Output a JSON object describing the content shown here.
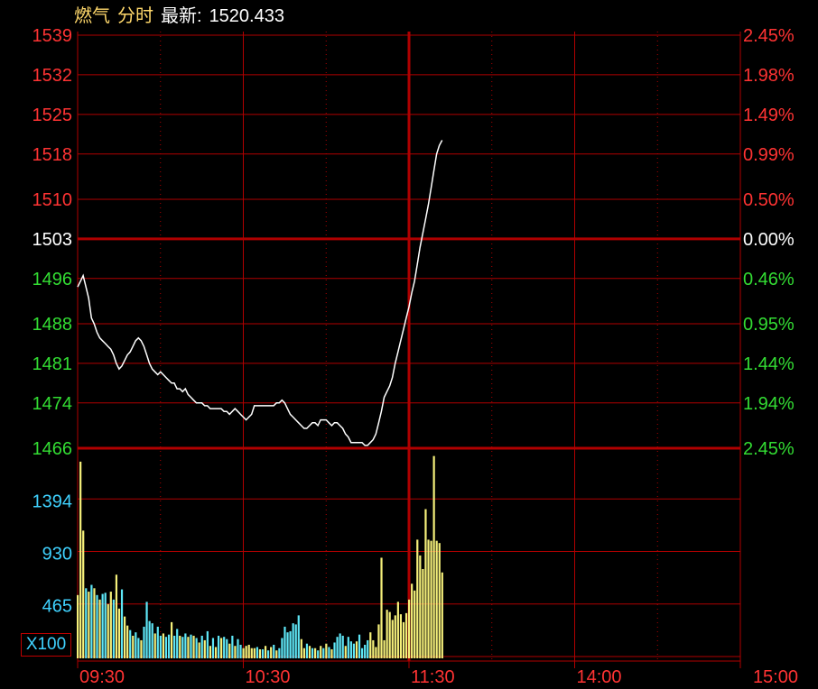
{
  "header": {
    "name": "燃气",
    "mode": "分时",
    "latest_label": "最新:",
    "latest_value": "1520.433"
  },
  "colors": {
    "background": "#000000",
    "grid": "#b00000",
    "up": "#ff3333",
    "down": "#33dd33",
    "neutral": "#ffffff",
    "price_line": "#ffffff",
    "volume_up": "#f5f07a",
    "volume_down": "#5ee7f7",
    "volume_axis": "#3fd2ff",
    "title": "#ffd86b"
  },
  "chart_data": {
    "type": "line",
    "prev_close": 1503,
    "price_axis": {
      "ylim": [
        1466,
        1539
      ],
      "ticks": [
        {
          "label": "1539",
          "value": 1539,
          "side": "up"
        },
        {
          "label": "1532",
          "value": 1532,
          "side": "up"
        },
        {
          "label": "1525",
          "value": 1525,
          "side": "up"
        },
        {
          "label": "1518",
          "value": 1518,
          "side": "up"
        },
        {
          "label": "1510",
          "value": 1510,
          "side": "up"
        },
        {
          "label": "1503",
          "value": 1503,
          "side": "flat"
        },
        {
          "label": "1496",
          "value": 1496,
          "side": "down"
        },
        {
          "label": "1488",
          "value": 1488,
          "side": "down"
        },
        {
          "label": "1481",
          "value": 1481,
          "side": "down"
        },
        {
          "label": "1474",
          "value": 1474,
          "side": "down"
        },
        {
          "label": "1466",
          "value": 1466,
          "side": "down"
        }
      ]
    },
    "pct_axis": {
      "ticks": [
        {
          "label": "2.45%",
          "side": "up"
        },
        {
          "label": "1.98%",
          "side": "up"
        },
        {
          "label": "1.49%",
          "side": "up"
        },
        {
          "label": "0.99%",
          "side": "up"
        },
        {
          "label": "0.50%",
          "side": "up"
        },
        {
          "label": "0.00%",
          "side": "flat"
        },
        {
          "label": "0.46%",
          "side": "down"
        },
        {
          "label": "0.95%",
          "side": "down"
        },
        {
          "label": "1.44%",
          "side": "down"
        },
        {
          "label": "1.94%",
          "side": "down"
        },
        {
          "label": "2.45%",
          "side": "down"
        }
      ]
    },
    "x_axis": {
      "total_minutes": 240,
      "labels": [
        {
          "label": "09:30",
          "minute": 0
        },
        {
          "label": "10:30",
          "minute": 60
        },
        {
          "label": "11:30",
          "minute": 120
        },
        {
          "label": "14:00",
          "minute": 180
        },
        {
          "label": "15:00",
          "minute": 240
        }
      ]
    },
    "price_series": {
      "name": "",
      "points": [
        [
          0,
          1494.5
        ],
        [
          1,
          1495.5
        ],
        [
          2,
          1496.5
        ],
        [
          3,
          1494.5
        ],
        [
          4,
          1492.5
        ],
        [
          5,
          1489.0
        ],
        [
          6,
          1488.0
        ],
        [
          7,
          1486.5
        ],
        [
          8,
          1485.5
        ],
        [
          9,
          1485.0
        ],
        [
          10,
          1484.5
        ],
        [
          11,
          1484.0
        ],
        [
          12,
          1483.5
        ],
        [
          13,
          1482.5
        ],
        [
          14,
          1481.0
        ],
        [
          15,
          1480.0
        ],
        [
          16,
          1480.5
        ],
        [
          17,
          1481.5
        ],
        [
          18,
          1482.5
        ],
        [
          19,
          1483.0
        ],
        [
          20,
          1484.0
        ],
        [
          21,
          1485.0
        ],
        [
          22,
          1485.5
        ],
        [
          23,
          1485.0
        ],
        [
          24,
          1484.0
        ],
        [
          25,
          1482.5
        ],
        [
          26,
          1481.0
        ],
        [
          27,
          1480.0
        ],
        [
          28,
          1479.5
        ],
        [
          29,
          1479.0
        ],
        [
          30,
          1479.5
        ],
        [
          31,
          1479.0
        ],
        [
          32,
          1478.5
        ],
        [
          33,
          1478.0
        ],
        [
          34,
          1477.5
        ],
        [
          35,
          1477.5
        ],
        [
          36,
          1476.5
        ],
        [
          37,
          1476.5
        ],
        [
          38,
          1476.0
        ],
        [
          39,
          1476.5
        ],
        [
          40,
          1475.5
        ],
        [
          41,
          1475.0
        ],
        [
          42,
          1474.5
        ],
        [
          43,
          1474.0
        ],
        [
          44,
          1474.0
        ],
        [
          45,
          1474.0
        ],
        [
          46,
          1473.5
        ],
        [
          47,
          1473.5
        ],
        [
          48,
          1473.0
        ],
        [
          49,
          1473.0
        ],
        [
          50,
          1473.0
        ],
        [
          51,
          1473.0
        ],
        [
          52,
          1473.0
        ],
        [
          53,
          1472.5
        ],
        [
          54,
          1472.5
        ],
        [
          55,
          1472.0
        ],
        [
          56,
          1472.5
        ],
        [
          57,
          1473.0
        ],
        [
          58,
          1472.5
        ],
        [
          59,
          1472.0
        ],
        [
          60,
          1471.5
        ],
        [
          61,
          1471.0
        ],
        [
          62,
          1471.5
        ],
        [
          63,
          1472.0
        ],
        [
          64,
          1473.5
        ],
        [
          65,
          1473.5
        ],
        [
          66,
          1473.5
        ],
        [
          67,
          1473.5
        ],
        [
          68,
          1473.5
        ],
        [
          69,
          1473.5
        ],
        [
          70,
          1473.5
        ],
        [
          71,
          1473.5
        ],
        [
          72,
          1474.0
        ],
        [
          73,
          1474.0
        ],
        [
          74,
          1474.5
        ],
        [
          75,
          1474.0
        ],
        [
          76,
          1473.0
        ],
        [
          77,
          1472.0
        ],
        [
          78,
          1471.5
        ],
        [
          79,
          1471.0
        ],
        [
          80,
          1470.5
        ],
        [
          81,
          1470.0
        ],
        [
          82,
          1469.5
        ],
        [
          83,
          1469.5
        ],
        [
          84,
          1470.0
        ],
        [
          85,
          1470.5
        ],
        [
          86,
          1470.5
        ],
        [
          87,
          1470.0
        ],
        [
          88,
          1471.0
        ],
        [
          89,
          1471.0
        ],
        [
          90,
          1471.0
        ],
        [
          91,
          1470.5
        ],
        [
          92,
          1470.0
        ],
        [
          93,
          1470.5
        ],
        [
          94,
          1470.5
        ],
        [
          95,
          1470.0
        ],
        [
          96,
          1469.5
        ],
        [
          97,
          1468.5
        ],
        [
          98,
          1468.0
        ],
        [
          99,
          1467.0
        ],
        [
          100,
          1467.0
        ],
        [
          101,
          1467.0
        ],
        [
          102,
          1467.0
        ],
        [
          103,
          1467.0
        ],
        [
          104,
          1466.5
        ],
        [
          105,
          1466.5
        ],
        [
          106,
          1467.0
        ],
        [
          107,
          1467.5
        ],
        [
          108,
          1468.5
        ],
        [
          109,
          1470.5
        ],
        [
          110,
          1472.5
        ],
        [
          111,
          1475.0
        ],
        [
          112,
          1476.0
        ],
        [
          113,
          1477.0
        ],
        [
          114,
          1478.5
        ],
        [
          115,
          1481.0
        ],
        [
          116,
          1483.0
        ],
        [
          117,
          1485.0
        ],
        [
          118,
          1487.0
        ],
        [
          119,
          1489.0
        ],
        [
          120,
          1491.0
        ],
        [
          121,
          1493.5
        ],
        [
          122,
          1495.5
        ],
        [
          123,
          1498.5
        ],
        [
          124,
          1501.5
        ],
        [
          125,
          1504.0
        ],
        [
          126,
          1506.5
        ],
        [
          127,
          1509.0
        ],
        [
          128,
          1512.0
        ],
        [
          129,
          1515.0
        ],
        [
          130,
          1518.0
        ],
        [
          131,
          1519.5
        ],
        [
          132,
          1520.433
        ]
      ]
    },
    "volume_axis": {
      "ylim": [
        0,
        1859
      ],
      "unit_label": "X100",
      "ticks": [
        {
          "label": "1394",
          "value": 1394
        },
        {
          "label": "930",
          "value": 930
        },
        {
          "label": "465",
          "value": 465
        }
      ]
    },
    "volume_series": {
      "name": "",
      "bars": [
        [
          0,
          560,
          "up"
        ],
        [
          1,
          1740,
          "up"
        ],
        [
          2,
          1130,
          "up"
        ],
        [
          3,
          620,
          "down"
        ],
        [
          4,
          590,
          "up"
        ],
        [
          5,
          650,
          "down"
        ],
        [
          6,
          620,
          "up"
        ],
        [
          7,
          560,
          "down"
        ],
        [
          8,
          520,
          "up"
        ],
        [
          9,
          570,
          "down"
        ],
        [
          10,
          580,
          "down"
        ],
        [
          11,
          480,
          "up"
        ],
        [
          12,
          590,
          "up"
        ],
        [
          13,
          520,
          "down"
        ],
        [
          14,
          740,
          "up"
        ],
        [
          15,
          440,
          "up"
        ],
        [
          16,
          610,
          "down"
        ],
        [
          17,
          370,
          "up"
        ],
        [
          18,
          290,
          "up"
        ],
        [
          19,
          250,
          "down"
        ],
        [
          20,
          200,
          "up"
        ],
        [
          21,
          230,
          "down"
        ],
        [
          22,
          180,
          "down"
        ],
        [
          23,
          160,
          "up"
        ],
        [
          24,
          280,
          "down"
        ],
        [
          25,
          500,
          "down"
        ],
        [
          26,
          330,
          "down"
        ],
        [
          27,
          310,
          "down"
        ],
        [
          28,
          220,
          "up"
        ],
        [
          29,
          280,
          "down"
        ],
        [
          30,
          200,
          "down"
        ],
        [
          31,
          220,
          "up"
        ],
        [
          32,
          190,
          "down"
        ],
        [
          33,
          210,
          "down"
        ],
        [
          34,
          320,
          "up"
        ],
        [
          35,
          200,
          "down"
        ],
        [
          36,
          260,
          "down"
        ],
        [
          37,
          200,
          "up"
        ],
        [
          38,
          190,
          "down"
        ],
        [
          39,
          220,
          "down"
        ],
        [
          40,
          190,
          "up"
        ],
        [
          41,
          210,
          "down"
        ],
        [
          42,
          200,
          "up"
        ],
        [
          43,
          180,
          "down"
        ],
        [
          44,
          140,
          "up"
        ],
        [
          45,
          200,
          "down"
        ],
        [
          46,
          160,
          "up"
        ],
        [
          47,
          240,
          "down"
        ],
        [
          48,
          110,
          "up"
        ],
        [
          49,
          180,
          "down"
        ],
        [
          50,
          100,
          "up"
        ],
        [
          51,
          200,
          "down"
        ],
        [
          52,
          180,
          "up"
        ],
        [
          53,
          190,
          "down"
        ],
        [
          54,
          170,
          "down"
        ],
        [
          55,
          130,
          "up"
        ],
        [
          56,
          200,
          "down"
        ],
        [
          57,
          110,
          "up"
        ],
        [
          58,
          170,
          "down"
        ],
        [
          59,
          120,
          "down"
        ],
        [
          60,
          90,
          "up"
        ],
        [
          61,
          110,
          "up"
        ],
        [
          62,
          120,
          "up"
        ],
        [
          63,
          90,
          "up"
        ],
        [
          64,
          90,
          "up"
        ],
        [
          65,
          100,
          "down"
        ],
        [
          66,
          80,
          "up"
        ],
        [
          67,
          80,
          "down"
        ],
        [
          68,
          110,
          "up"
        ],
        [
          69,
          70,
          "down"
        ],
        [
          70,
          100,
          "up"
        ],
        [
          71,
          120,
          "down"
        ],
        [
          72,
          70,
          "up"
        ],
        [
          73,
          90,
          "down"
        ],
        [
          74,
          180,
          "down"
        ],
        [
          75,
          280,
          "down"
        ],
        [
          76,
          230,
          "down"
        ],
        [
          77,
          240,
          "down"
        ],
        [
          78,
          310,
          "down"
        ],
        [
          79,
          300,
          "down"
        ],
        [
          80,
          380,
          "down"
        ],
        [
          81,
          170,
          "up"
        ],
        [
          82,
          90,
          "up"
        ],
        [
          83,
          130,
          "down"
        ],
        [
          84,
          110,
          "up"
        ],
        [
          85,
          90,
          "down"
        ],
        [
          86,
          90,
          "up"
        ],
        [
          87,
          70,
          "down"
        ],
        [
          88,
          110,
          "up"
        ],
        [
          89,
          90,
          "down"
        ],
        [
          90,
          130,
          "up"
        ],
        [
          91,
          100,
          "down"
        ],
        [
          92,
          80,
          "up"
        ],
        [
          93,
          140,
          "down"
        ],
        [
          94,
          190,
          "down"
        ],
        [
          95,
          220,
          "down"
        ],
        [
          96,
          200,
          "down"
        ],
        [
          97,
          110,
          "up"
        ],
        [
          98,
          190,
          "down"
        ],
        [
          99,
          150,
          "down"
        ],
        [
          100,
          130,
          "down"
        ],
        [
          101,
          150,
          "up"
        ],
        [
          102,
          210,
          "down"
        ],
        [
          103,
          90,
          "down"
        ],
        [
          104,
          120,
          "down"
        ],
        [
          105,
          160,
          "down"
        ],
        [
          106,
          230,
          "up"
        ],
        [
          107,
          160,
          "up"
        ],
        [
          108,
          100,
          "up"
        ],
        [
          109,
          300,
          "up"
        ],
        [
          110,
          890,
          "up"
        ],
        [
          111,
          160,
          "up"
        ],
        [
          112,
          430,
          "up"
        ],
        [
          113,
          410,
          "up"
        ],
        [
          114,
          340,
          "up"
        ],
        [
          115,
          380,
          "up"
        ],
        [
          116,
          500,
          "up"
        ],
        [
          117,
          390,
          "up"
        ],
        [
          118,
          320,
          "up"
        ],
        [
          119,
          400,
          "up"
        ],
        [
          120,
          520,
          "up"
        ],
        [
          121,
          660,
          "up"
        ],
        [
          122,
          600,
          "up"
        ],
        [
          123,
          1050,
          "up"
        ],
        [
          124,
          910,
          "up"
        ],
        [
          125,
          790,
          "up"
        ],
        [
          126,
          1320,
          "up"
        ],
        [
          127,
          1050,
          "up"
        ],
        [
          128,
          1040,
          "up"
        ],
        [
          129,
          1790,
          "up"
        ],
        [
          130,
          1040,
          "up"
        ],
        [
          131,
          1020,
          "up"
        ],
        [
          132,
          760,
          "up"
        ]
      ]
    }
  }
}
